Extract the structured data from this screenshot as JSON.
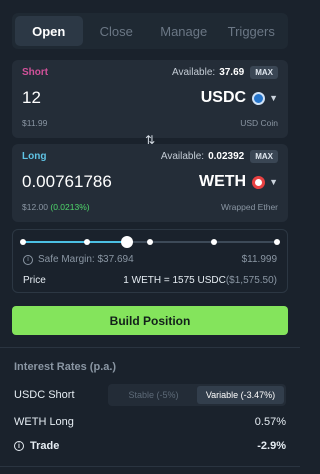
{
  "tabs": [
    "Open",
    "Close",
    "Manage",
    "Triggers"
  ],
  "short": {
    "label": "Short",
    "available_label": "Available:",
    "available_value": "37.69",
    "max_label": "MAX",
    "amount": "12",
    "token": "USDC",
    "usd_value": "$11.99",
    "token_name": "USD Coin"
  },
  "long": {
    "label": "Long",
    "available_label": "Available:",
    "available_value": "0.02392",
    "max_label": "MAX",
    "amount": "0.00761786",
    "token": "WETH",
    "usd_value": "$12.00",
    "usd_change": "(0.0213%)",
    "token_name": "Wrapped Ether"
  },
  "slider": {
    "level": 0.41,
    "safe_margin_label": "Safe Margin:",
    "safe_margin_value": "$37.694",
    "max_value": "$11.999",
    "price_label": "Price",
    "price_value": "1 WETH = 1575 USDC",
    "price_usd": "($1,575.50)"
  },
  "build_button": "Build Position",
  "interest": {
    "title": "Interest Rates (p.a.)",
    "usdc_label": "USDC Short",
    "stable_option": "Stable (-5%)",
    "variable_option": "Variable (-3.47%)",
    "weth_label": "WETH Long",
    "weth_value": "0.57%",
    "trade_label": "Trade",
    "trade_value": "-2.9%"
  },
  "colors": {
    "short_accent": "#d1519a",
    "long_accent": "#5fc3e4",
    "build_button": "#84e45c",
    "positive": "#4fd66b"
  }
}
